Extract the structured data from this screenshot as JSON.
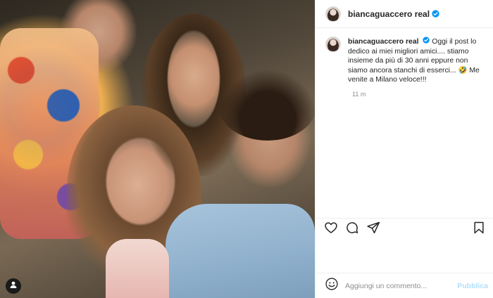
{
  "post": {
    "username": "biancaguaccero real",
    "caption": "Oggi il post lo dedico ai miei migliori amici.... stiamo insieme da più di 30 anni eppure non siamo ancora stanchi di esserci... 🤣 Me venite a Milano veloce!!!",
    "time": "11 m",
    "verified": true
  },
  "comment_box": {
    "placeholder": "Aggiungi un commento...",
    "publish_label": "Pubblica"
  },
  "icons": {
    "like": "heart-icon",
    "comment": "comment-bubble-icon",
    "share": "paper-plane-icon",
    "save": "bookmark-icon",
    "emoji": "smiley-icon",
    "tag": "user-tag-icon",
    "verified": "verified-badge-icon"
  },
  "colors": {
    "verified": "#0095f6",
    "publish_disabled": "#b2dffc",
    "secondary_text": "#8e8e8e"
  }
}
